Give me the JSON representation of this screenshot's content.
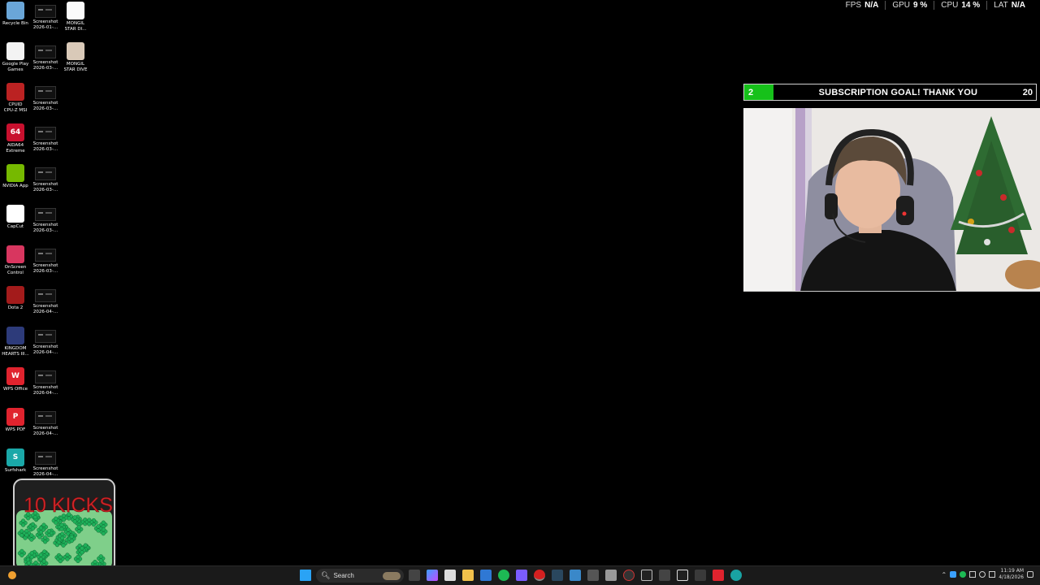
{
  "perf_overlay": {
    "fps_label": "FPS",
    "fps_value": "N/A",
    "gpu_label": "GPU",
    "gpu_value": "9 %",
    "cpu_label": "CPU",
    "cpu_value": "14 %",
    "lat_label": "LAT",
    "lat_value": "N/A"
  },
  "desktop": {
    "col1": [
      {
        "label": "Recycle Bin",
        "icon": "recycle-bin-icon"
      },
      {
        "label": "Google Play\nGames",
        "icon": "google-play-games-icon"
      },
      {
        "label": "CPUID\nCPU-Z MSI",
        "icon": "cpu-z-icon"
      },
      {
        "label": "AIDA64\nExtreme",
        "icon": "aida64-icon",
        "glyph": "64"
      },
      {
        "label": "NVIDIA App",
        "icon": "nvidia-icon"
      },
      {
        "label": "CapCut",
        "icon": "capcut-icon"
      },
      {
        "label": "OnScreen\nControl",
        "icon": "onscreen-control-icon"
      },
      {
        "label": "Dota 2",
        "icon": "dota2-icon"
      },
      {
        "label": "KINGDOM\nHEARTS III...",
        "icon": "kingdom-hearts-icon"
      },
      {
        "label": "WPS Office",
        "icon": "wps-office-icon",
        "glyph": "W"
      },
      {
        "label": "WPS PDF",
        "icon": "wps-pdf-icon",
        "glyph": "P"
      },
      {
        "label": "Surfshark",
        "icon": "surfshark-icon",
        "glyph": "S"
      }
    ],
    "col2": [
      {
        "label": "Screenshot\n2026-01-..."
      },
      {
        "label": "Screenshot\n2026-03-..."
      },
      {
        "label": "Screenshot\n2026-03-..."
      },
      {
        "label": "Screenshot\n2026-03-..."
      },
      {
        "label": "Screenshot\n2026-03-..."
      },
      {
        "label": "Screenshot\n2026-03-..."
      },
      {
        "label": "Screenshot\n2026-03-..."
      },
      {
        "label": "Screenshot\n2026-04-..."
      },
      {
        "label": "Screenshot\n2026-04-..."
      },
      {
        "label": "Screenshot\n2026-04-..."
      },
      {
        "label": "Screenshot\n2026-04-..."
      },
      {
        "label": "Screenshot\n2026-04-..."
      }
    ],
    "col3": [
      {
        "label": "MONGIL\nSTAR DI..."
      },
      {
        "label": "MONGIL\nSTAR DIVE"
      }
    ]
  },
  "subscription_goal": {
    "current": "2",
    "title": "SUBSCRIPTION GOAL! THANK YOU",
    "target": "20",
    "progress_fraction": 0.1,
    "fill_color": "#16c11a"
  },
  "kicks_jar": {
    "title": "10 KICKS",
    "title_color": "#d2272a",
    "clover_color": "#1fb15a"
  },
  "taskbar": {
    "search_placeholder": "Search",
    "clock_time": "11:19 AM",
    "clock_date": "4/18/2026"
  }
}
